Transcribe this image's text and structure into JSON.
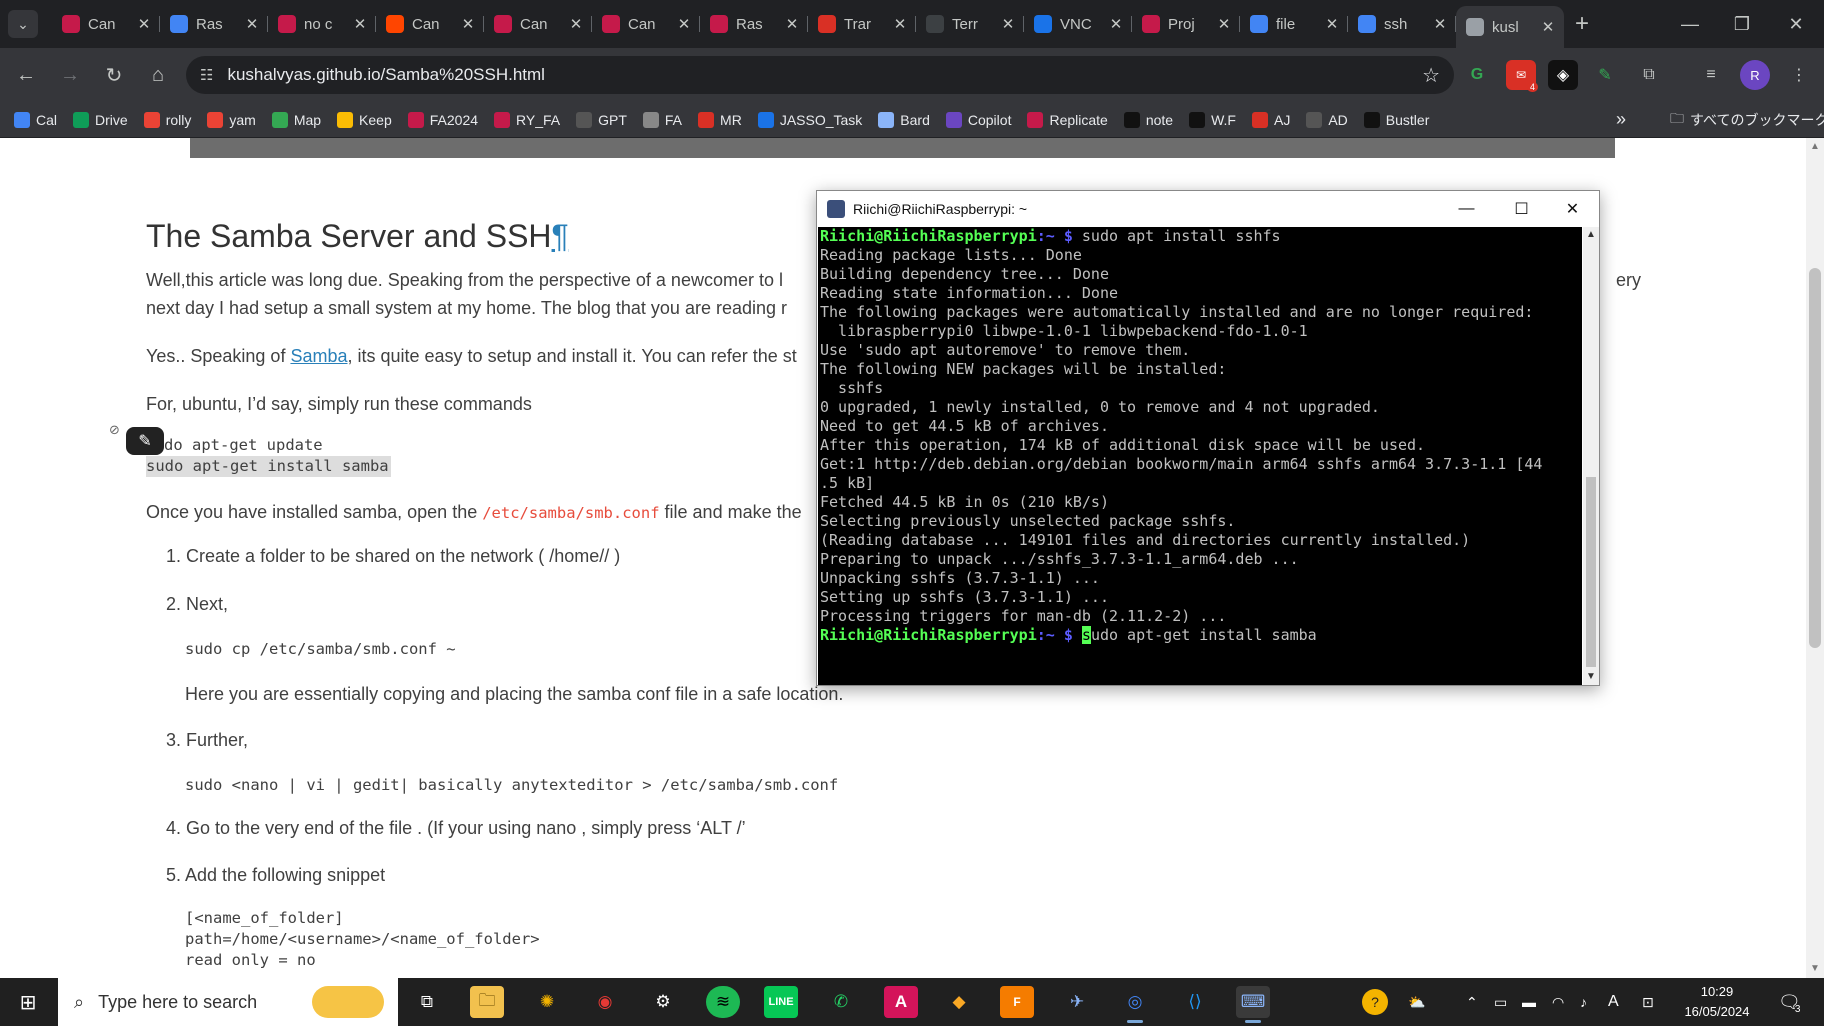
{
  "browser": {
    "tabs": [
      {
        "label": "Can",
        "icon": "raspberry-icon",
        "color": "#c51a4a"
      },
      {
        "label": "Ras",
        "icon": "docs-icon",
        "color": "#4285f4"
      },
      {
        "label": "no c",
        "icon": "raspberry-icon",
        "color": "#c51a4a"
      },
      {
        "label": "Can",
        "icon": "reddit-icon",
        "color": "#ff4500"
      },
      {
        "label": "Can",
        "icon": "raspberry-icon",
        "color": "#c51a4a"
      },
      {
        "label": "Can",
        "icon": "raspberry-icon",
        "color": "#c51a4a"
      },
      {
        "label": "Ras",
        "icon": "raspberry-icon",
        "color": "#c51a4a"
      },
      {
        "label": "Trar",
        "icon": "record-icon",
        "color": "#d93025"
      },
      {
        "label": "Terr",
        "icon": "terminal-icon",
        "color": "#3c4043"
      },
      {
        "label": "VNC",
        "icon": "vnc-icon",
        "color": "#1a73e8"
      },
      {
        "label": "Proj",
        "icon": "project-icon",
        "color": "#c51a4a"
      },
      {
        "label": "file",
        "icon": "google-icon",
        "color": "#4285f4"
      },
      {
        "label": "ssh",
        "icon": "ssh-icon",
        "color": "#4285f4"
      },
      {
        "label": "kusl",
        "icon": "globe-icon",
        "color": "#9aa0a6",
        "active": true
      }
    ],
    "url": "kushalvyas.github.io/Samba%20SSH.html",
    "bookmarks": [
      {
        "label": "Cal",
        "color": "#4285f4"
      },
      {
        "label": "Drive",
        "color": "#0f9d58"
      },
      {
        "label": "rolly",
        "color": "#ea4335"
      },
      {
        "label": "yam",
        "color": "#ea4335"
      },
      {
        "label": "Map",
        "color": "#34a853"
      },
      {
        "label": "Keep",
        "color": "#fbbc04"
      },
      {
        "label": "FA2024",
        "color": "#c51a4a"
      },
      {
        "label": "RY_FA",
        "color": "#c51a4a"
      },
      {
        "label": "GPT",
        "color": "#555"
      },
      {
        "label": "FA",
        "color": "#888"
      },
      {
        "label": "MR",
        "color": "#d93025"
      },
      {
        "label": "JASSO_Task",
        "color": "#1a73e8"
      },
      {
        "label": "Bard",
        "color": "#8ab4f8"
      },
      {
        "label": "Copilot",
        "color": "#6b46c1"
      },
      {
        "label": "Replicate",
        "color": "#c51a4a"
      },
      {
        "label": "note",
        "color": "#111"
      },
      {
        "label": "W.F",
        "color": "#111"
      },
      {
        "label": "AJ",
        "color": "#d93025"
      },
      {
        "label": "AD",
        "color": "#555"
      },
      {
        "label": "Bustler",
        "color": "#111"
      }
    ],
    "bookmarks_all": "すべてのブックマーク",
    "overflow": "»",
    "profile_initial": "R",
    "ext_badge": "4"
  },
  "article": {
    "title": "The Samba Server and SSH",
    "pilcrow": "¶",
    "para1_line1": "Well,this article was long due. Speaking from the perspective of a newcomer to l",
    "para1_tail": "ery",
    "para1_line2": "next day I had setup a small system at my home. The blog that you are reading r",
    "para2_pre": "Yes.. Speaking of ",
    "para2_link": "Samba",
    "para2_post": ", its quite easy to setup and install it. You can refer the st",
    "para3": "For, ubuntu, I’d say, simply run these commands",
    "cmd1": "do apt-get update",
    "cmd2": "sudo apt-get install samba",
    "para4_pre": "Once you have installed samba, open the ",
    "para4_code": "/etc/samba/smb.conf",
    "para4_post": " file and make the",
    "steps": [
      {
        "num": "1.",
        "text": "Create a folder to be shared on the network ( /home// )"
      },
      {
        "num": "2.",
        "text": "Next,"
      },
      {
        "num": "3.",
        "text": "Further,"
      },
      {
        "num": "4.",
        "text": "Go to the very end of the file . (If your using nano , simply press ‘ALT /’"
      },
      {
        "num": "5.",
        "text": "Add the following snippet"
      }
    ],
    "step2_code": "sudo cp /etc/samba/smb.conf ~",
    "step2_note": "Here you are essentially copying and placing the samba conf file in a safe location.",
    "step3_code": "sudo <nano | vi | gedit| basically anytexteditor > /etc/samba/smb.conf",
    "snippet": [
      "[<name_of_folder]",
      "path=/home/<username>/<name_of_folder>",
      "read only = no"
    ]
  },
  "terminal": {
    "title": "Riichi@RiichiRaspberrypi: ~",
    "prompt_user": "Riichi@RiichiRaspberrypi",
    "prompt_path": ":~ $",
    "first_cmd": " sudo apt install sshfs",
    "lines": [
      "Reading package lists... Done",
      "Building dependency tree... Done",
      "Reading state information... Done",
      "The following packages were automatically installed and are no longer required:",
      "  libraspberrypi0 libwpe-1.0-1 libwpebackend-fdo-1.0-1",
      "Use 'sudo apt autoremove' to remove them.",
      "The following NEW packages will be installed:",
      "  sshfs",
      "0 upgraded, 1 newly installed, 0 to remove and 4 not upgraded.",
      "Need to get 44.5 kB of archives.",
      "After this operation, 174 kB of additional disk space will be used.",
      "Get:1 http://deb.debian.org/debian bookworm/main arm64 sshfs arm64 3.7.3-1.1 [44",
      ".5 kB]",
      "Fetched 44.5 kB in 0s (210 kB/s)",
      "Selecting previously unselected package sshfs.",
      "(Reading database ... 149101 files and directories currently installed.)",
      "Preparing to unpack .../sshfs_3.7.3-1.1_arm64.deb ...",
      "Unpacking sshfs (3.7.3-1.1) ...",
      "Setting up sshfs (3.7.3-1.1) ...",
      "Processing triggers for man-db (2.11.2-2) ..."
    ],
    "cursor_char": "s",
    "current_input": "udo apt-get install samba"
  },
  "taskbar": {
    "search_placeholder": "Type here to search",
    "time": "10:29",
    "date": "16/05/2024",
    "ime": "A",
    "notif_count": "3"
  }
}
